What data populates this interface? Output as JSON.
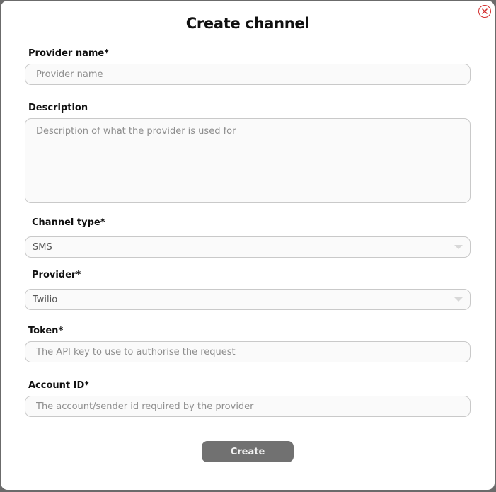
{
  "dialog": {
    "title": "Create channel",
    "close_icon": "close-circle-icon"
  },
  "provider_name": {
    "label": "Provider name*",
    "placeholder": "Provider name",
    "value": ""
  },
  "description": {
    "label": "Description",
    "placeholder": "Description of what the provider is used for",
    "value": ""
  },
  "channel_type": {
    "label": "Channel type*",
    "selected": "SMS",
    "icon": "chevron-down-icon"
  },
  "provider": {
    "label": "Provider*",
    "selected": "Twilio",
    "icon": "chevron-down-icon"
  },
  "token": {
    "label": "Token*",
    "placeholder": "The API key to use to authorise the request",
    "value": ""
  },
  "account_id": {
    "label": "Account ID*",
    "placeholder": "The account/sender id required by the provider",
    "value": ""
  },
  "actions": {
    "create_label": "Create"
  },
  "colors": {
    "close": "#d32f2f",
    "button": "#717171",
    "overlay": "#6b6b6b"
  }
}
